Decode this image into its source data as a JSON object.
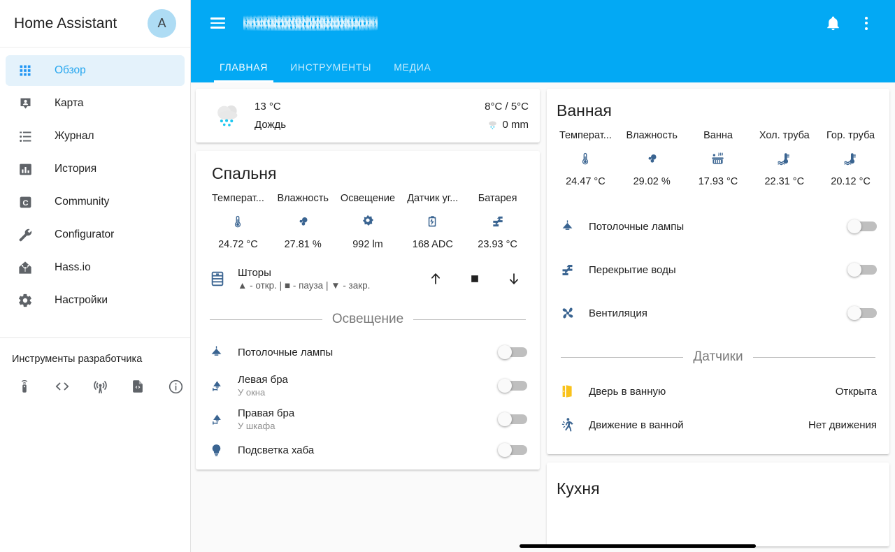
{
  "sidebar": {
    "title": "Home Assistant",
    "avatar_letter": "A",
    "items": [
      {
        "label": "Обзор",
        "icon": "grid-icon",
        "active": true
      },
      {
        "label": "Карта",
        "icon": "map-marker-icon",
        "active": false
      },
      {
        "label": "Журнал",
        "icon": "list-icon",
        "active": false
      },
      {
        "label": "История",
        "icon": "chart-bar-icon",
        "active": false
      },
      {
        "label": "Community",
        "icon": "community-icon",
        "active": false
      },
      {
        "label": "Configurator",
        "icon": "wrench-icon",
        "active": false
      },
      {
        "label": "Hass.io",
        "icon": "hassio-home-icon",
        "active": false
      },
      {
        "label": "Настройки",
        "icon": "gear-icon",
        "active": false
      }
    ],
    "devtools_title": "Инструменты разработчика",
    "devtools_icons": [
      "services-remote-icon",
      "code-brackets-icon",
      "events-broadcast-icon",
      "template-file-icon",
      "info-icon"
    ]
  },
  "appbar": {
    "title_redacted": true,
    "bell": "bell-icon",
    "overflow": "overflow-menu-icon",
    "menu": "hamburger-icon",
    "accent_color": "#03a9f4",
    "tabs": [
      {
        "label": "ГЛАВНАЯ",
        "active": true
      },
      {
        "label": "ИНСТРУМЕНТЫ",
        "active": false
      },
      {
        "label": "МЕДИА",
        "active": false
      }
    ]
  },
  "weather": {
    "icon": "rainy-cloud-icon",
    "temperature": "13 °C",
    "condition": "Дождь",
    "high_low": "8°C / 5°C",
    "precip_icon": "rain-small-icon",
    "precipitation": "0 mm"
  },
  "bedroom": {
    "title": "Спальня",
    "sensors": [
      {
        "name": "Температ...",
        "icon": "thermometer-icon",
        "value": "24.72 °C"
      },
      {
        "name": "Влажность",
        "icon": "water-percent-icon",
        "value": "27.81 %"
      },
      {
        "name": "Освещение",
        "icon": "brightness-icon",
        "value": "992 lm"
      },
      {
        "name": "Датчик уг...",
        "icon": "gas-canister-icon",
        "value": "168 ADC"
      },
      {
        "name": "Батарея",
        "icon": "flash-zigzag-icon",
        "value": "23.93 °C"
      }
    ],
    "cover": {
      "icon": "blinds-icon",
      "name": "Шторы",
      "sub": "▲ - откр. | ■ - пауза | ▼ - закр.",
      "buttons": [
        "arrow-up-icon",
        "stop-square-icon",
        "arrow-down-icon"
      ]
    },
    "section_lighting": "Освещение",
    "lights": [
      {
        "icon": "ceiling-light-icon",
        "name": "Потолочные лампы",
        "sub": "",
        "on": false
      },
      {
        "icon": "wall-sconce-icon",
        "name": "Левая бра",
        "sub": "У окна",
        "on": false
      },
      {
        "icon": "wall-sconce-icon",
        "name": "Правая бра",
        "sub": "У шкафа",
        "on": false
      },
      {
        "icon": "lightbulb-icon",
        "name": "Подсветка хаба",
        "sub": "",
        "on": false
      }
    ]
  },
  "bathroom": {
    "title": "Ванная",
    "sensors": [
      {
        "name": "Температ...",
        "icon": "thermometer-icon",
        "value": "24.47 °C"
      },
      {
        "name": "Влажность",
        "icon": "water-percent-icon",
        "value": "29.02 %"
      },
      {
        "name": "Ванна",
        "icon": "hot-tub-icon",
        "value": "17.93 °C"
      },
      {
        "name": "Хол. труба",
        "icon": "water-thermometer-icon",
        "value": "22.31 °C"
      },
      {
        "name": "Гор. труба",
        "icon": "water-thermometer-icon",
        "value": "20.12 °C"
      }
    ],
    "controls": [
      {
        "icon": "ceiling-light-icon",
        "name": "Потолочные лампы",
        "on": false
      },
      {
        "icon": "water-valve-icon",
        "name": "Перекрытие воды",
        "on": false
      },
      {
        "icon": "fan-icon",
        "name": "Вентиляция",
        "on": false
      }
    ],
    "section_sensors": "Датчики",
    "binary_sensors": [
      {
        "icon": "door-open-icon",
        "icon_color": "#f9c21b",
        "name": "Дверь в ванную",
        "state": "Открыта"
      },
      {
        "icon": "motion-walk-icon",
        "icon_color": "#3a6491",
        "name": "Движение в ванной",
        "state": "Нет движения"
      }
    ]
  },
  "kitchen": {
    "title": "Кухня"
  }
}
